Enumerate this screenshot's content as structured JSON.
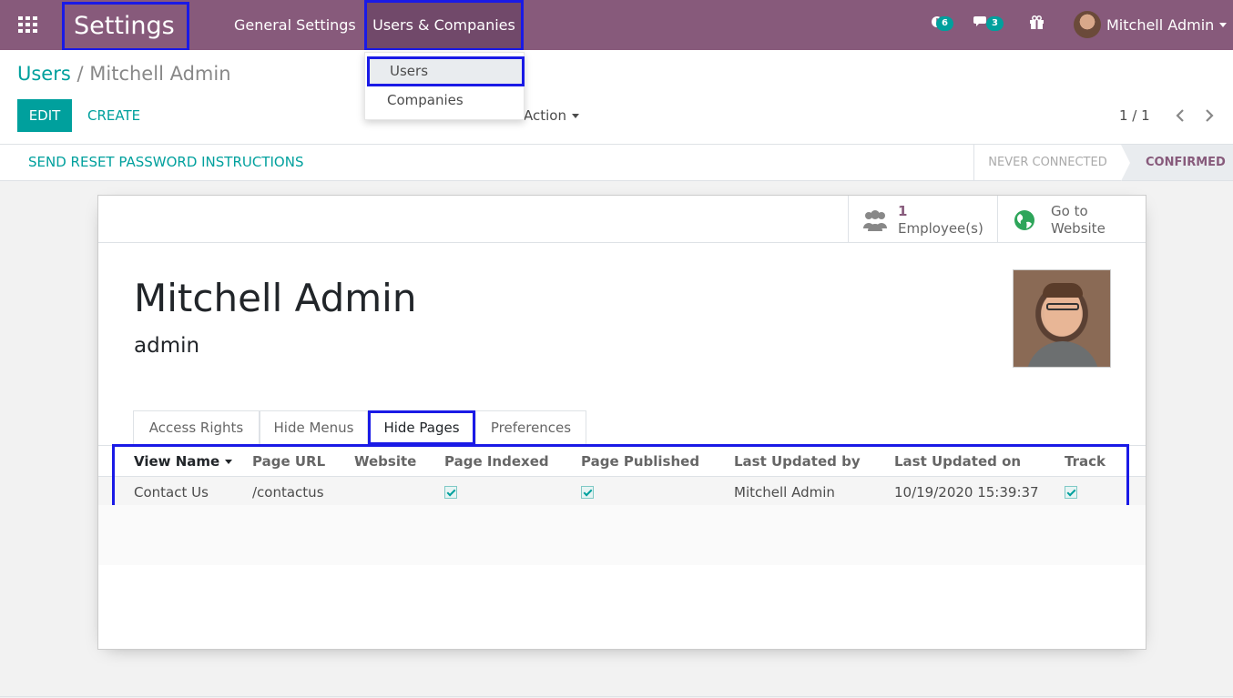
{
  "navbar": {
    "brand": "Settings",
    "menu": [
      {
        "label": "General Settings"
      },
      {
        "label": "Users & Companies"
      }
    ],
    "activity_count": "6",
    "message_count": "3",
    "user_name": "Mitchell Admin"
  },
  "dropdown": {
    "items": [
      {
        "label": "Users"
      },
      {
        "label": "Companies"
      }
    ]
  },
  "breadcrumb": {
    "parent": "Users",
    "separator": "/",
    "current": "Mitchell Admin"
  },
  "buttons": {
    "edit": "EDIT",
    "create": "CREATE",
    "action": "Action",
    "reset_password": "SEND RESET PASSWORD INSTRUCTIONS"
  },
  "pager": {
    "value": "1 / 1"
  },
  "statusbar": {
    "stages": [
      {
        "label": "NEVER CONNECTED",
        "active": false
      },
      {
        "label": "CONFIRMED",
        "active": true
      }
    ]
  },
  "smart_buttons": {
    "employees_count": "1",
    "employees_label": "Employee(s)",
    "website_line1": "Go to",
    "website_line2": "Website"
  },
  "user": {
    "name": "Mitchell Admin",
    "login": "admin"
  },
  "tabs": [
    {
      "label": "Access Rights"
    },
    {
      "label": "Hide Menus"
    },
    {
      "label": "Hide Pages"
    },
    {
      "label": "Preferences"
    }
  ],
  "table": {
    "columns": [
      "View Name",
      "Page URL",
      "Website",
      "Page Indexed",
      "Page Published",
      "Last Updated by",
      "Last Updated on",
      "Track"
    ],
    "rows": [
      {
        "view_name": "Contact Us",
        "page_url": "/contactus",
        "website": "",
        "page_indexed": true,
        "page_published": true,
        "last_updated_by": "Mitchell Admin",
        "last_updated_on": "10/19/2020 15:39:37",
        "track": true
      }
    ]
  },
  "colors": {
    "brand": "#875a7b",
    "accent": "#00a09d",
    "highlight": "#1a1ae6"
  }
}
